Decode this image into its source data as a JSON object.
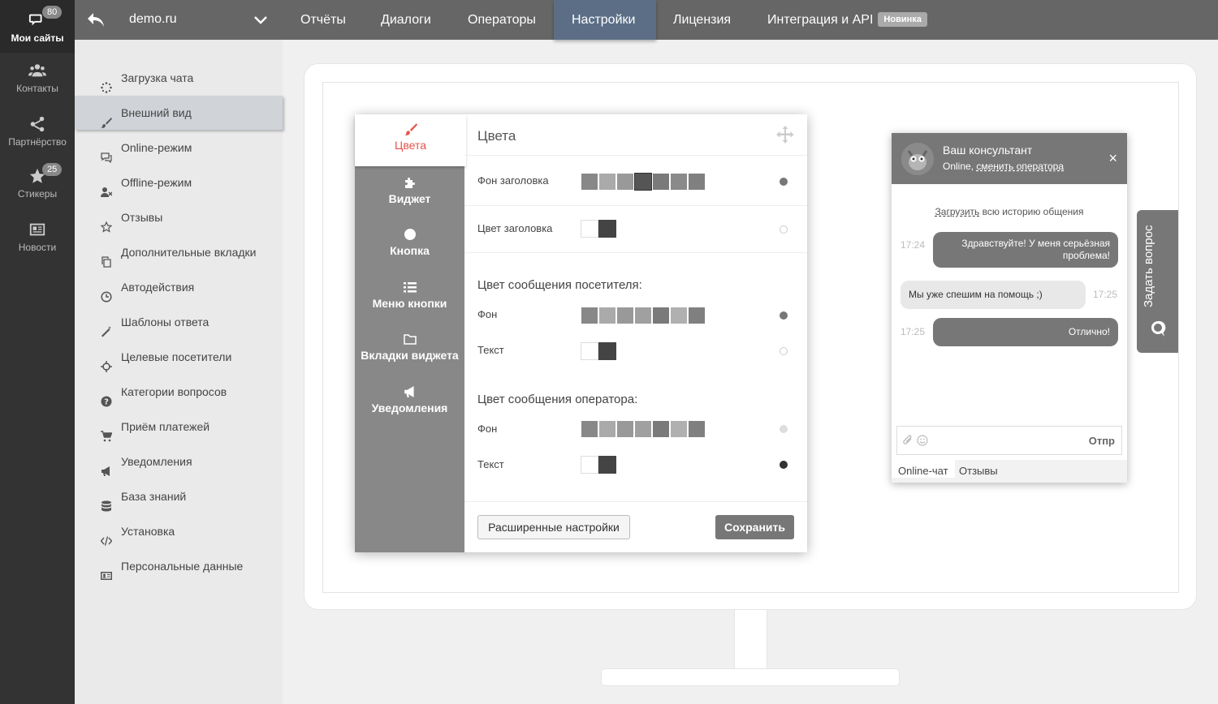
{
  "leftbar": {
    "items": [
      {
        "label": "Мои сайты",
        "icon": "chat-bubbles-icon",
        "badge": "80"
      },
      {
        "label": "Контакты",
        "icon": "contacts-icon"
      },
      {
        "label": "Партнёрство",
        "icon": "share-icon"
      },
      {
        "label": "Стикеры",
        "icon": "star-icon",
        "badge": "25"
      },
      {
        "label": "Новости",
        "icon": "news-icon"
      }
    ]
  },
  "topbar": {
    "site": "demo.ru",
    "nav": [
      {
        "label": "Отчёты"
      },
      {
        "label": "Диалоги"
      },
      {
        "label": "Операторы"
      },
      {
        "label": "Настройки",
        "active": true
      },
      {
        "label": "Лицензия"
      },
      {
        "label": "Интеграция и API",
        "badge": "Новинка"
      }
    ]
  },
  "menu": {
    "items": [
      {
        "label": "Загрузка чата",
        "icon": "spinner-icon"
      },
      {
        "label": "Внешний вид",
        "icon": "brush-icon",
        "active": true
      },
      {
        "label": "Online-режим",
        "icon": "comments-icon"
      },
      {
        "label": "Offline-режим",
        "icon": "user-off-icon"
      },
      {
        "label": "Отзывы",
        "icon": "star-outline-icon"
      },
      {
        "label": "Дополнительные вкладки",
        "icon": "copy-icon"
      },
      {
        "label": "Автодействия",
        "icon": "clock-icon"
      },
      {
        "label": "Шаблоны ответа",
        "icon": "magic-wand-icon"
      },
      {
        "label": "Целевые посетители",
        "icon": "crosshair-icon"
      },
      {
        "label": "Категории вопросов",
        "icon": "question-circle-icon"
      },
      {
        "label": "Приём платежей",
        "icon": "cart-icon"
      },
      {
        "label": "Уведомления",
        "icon": "bullhorn-icon"
      },
      {
        "label": "База знаний",
        "icon": "database-icon"
      },
      {
        "label": "Установка",
        "icon": "code-icon"
      },
      {
        "label": "Персональные данные",
        "icon": "id-card-icon"
      }
    ]
  },
  "panel": {
    "tabs": [
      {
        "label": "Цвета",
        "icon": "brush-icon",
        "active": true
      },
      {
        "label": "Виджет",
        "icon": "puzzle-icon"
      },
      {
        "label": "Кнопка",
        "icon": "circle-icon"
      },
      {
        "label": "Меню кнопки",
        "icon": "list-icon"
      },
      {
        "label": "Вкладки виджета",
        "icon": "folder-icon"
      },
      {
        "label": "Уведомления",
        "icon": "bullhorn-icon"
      }
    ],
    "title": "Цвета",
    "header_bg_label": "Фон заголовка",
    "header_color_label": "Цвет заголовка",
    "visitor_section": "Цвет сообщения посетителя:",
    "operator_section": "Цвет сообщения оператора:",
    "bg_label": "Фон",
    "text_label": "Текст",
    "advanced_button": "Расширенные настройки",
    "save_button": "Сохранить",
    "palette": [
      "#888888",
      "#aaaaaa",
      "#999999",
      "#555555",
      "#7a7a7a",
      "#9a9a9a",
      "#808080"
    ],
    "text_palette": [
      "#ffffff",
      "#444444"
    ]
  },
  "chat": {
    "name": "Ваш консультант",
    "status_prefix": "Online, ",
    "status_link": "сменить оператора",
    "close": "×",
    "history_link": "Загрузить",
    "history_rest": " всю историю общения",
    "messages": [
      {
        "time": "17:24",
        "text": "Здравствуйте! У меня серьёзная проблема!",
        "dir": "out"
      },
      {
        "time": "17:25",
        "text": "Мы уже спешим на помощь ;)",
        "dir": "in"
      },
      {
        "time": "17:25",
        "text": "Отлично!",
        "dir": "out"
      }
    ],
    "send": "Отпр",
    "footer_tabs": [
      "Online-чат",
      "Отзывы"
    ]
  },
  "ask_tab": {
    "label": "Задать вопрос"
  }
}
